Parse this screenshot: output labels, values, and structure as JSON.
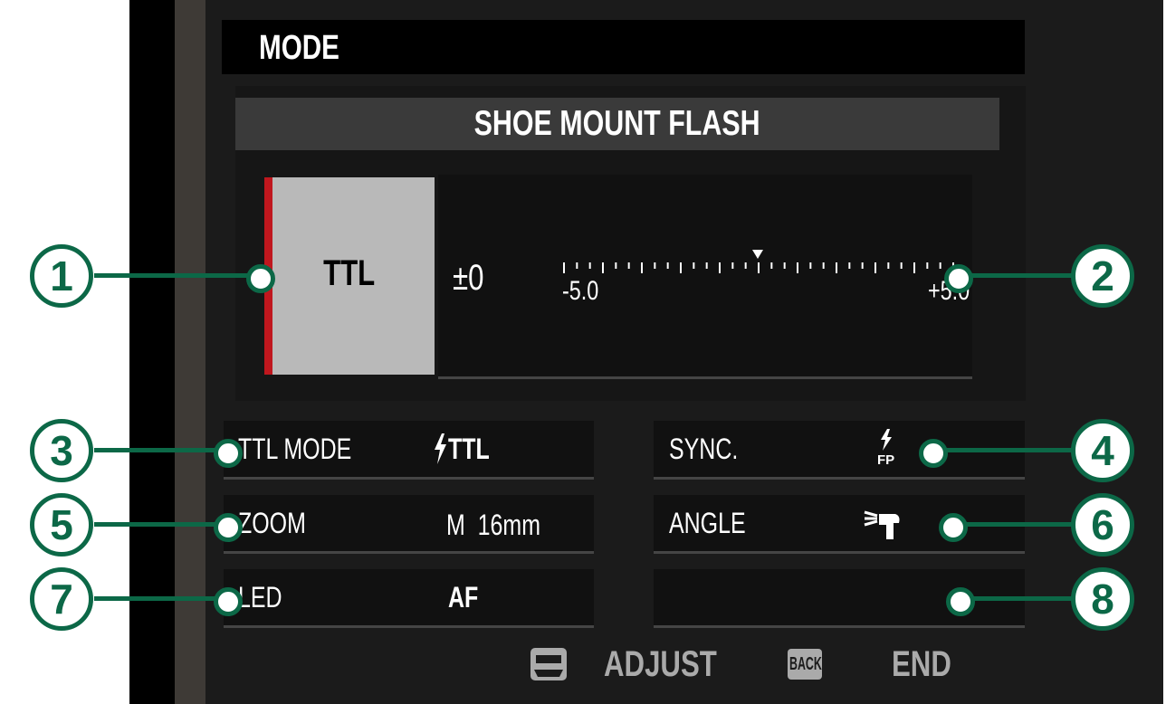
{
  "screen": {
    "title": "MODE",
    "subtitle": "SHOE MOUNT FLASH",
    "mode": "TTL",
    "compensation": "±0",
    "scale": {
      "min_label": "-5.0",
      "max_label": "+5.0",
      "current": 0
    }
  },
  "settings": {
    "ttl_mode": {
      "label": "TTL MODE",
      "value": "TTL",
      "icon": "flash-icon"
    },
    "sync": {
      "label": "SYNC.",
      "value_icon": "fp-flash-sync-icon",
      "fp_text": "FP"
    },
    "zoom": {
      "label": "ZOOM",
      "value": "M  16mm"
    },
    "angle": {
      "label": "ANGLE",
      "value_icon": "flash-angle-icon"
    },
    "led": {
      "label": "LED",
      "value": "AF"
    },
    "empty": {
      "label": ""
    }
  },
  "bottom_bar": {
    "adjust_label": "ADJUST",
    "back_label": "BACK",
    "end_label": "END"
  },
  "callouts": [
    "1",
    "2",
    "3",
    "4",
    "5",
    "6",
    "7",
    "8"
  ],
  "colors": {
    "callout": "#0c6847",
    "mode_accent": "#c0171e",
    "mode_box": "#b9b9b9"
  }
}
